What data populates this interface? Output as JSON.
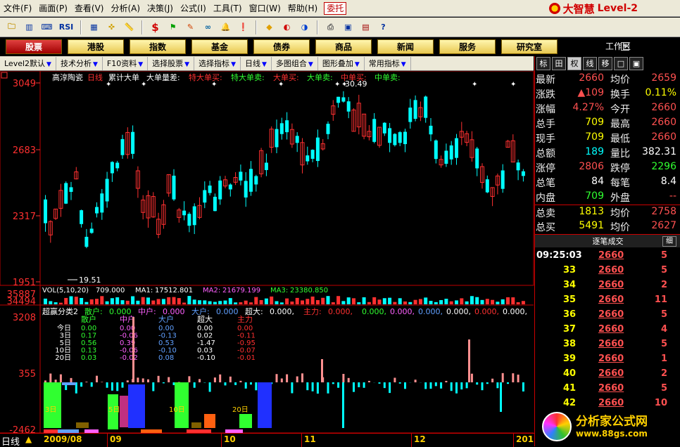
{
  "menu": {
    "items": [
      "文件(F)",
      "画面(P)",
      "查看(V)",
      "分析(A)",
      "决策(J)",
      "公式(I)",
      "工具(T)",
      "窗口(W)",
      "帮助(H)"
    ],
    "delegate": "委托",
    "brand_cn": "大智慧",
    "brand_en": "Level-2"
  },
  "toolbar": {
    "icons": [
      "folder-icon",
      "chart-icon",
      "keyboard-icon",
      "rsi-icon",
      "calc-icon",
      "crosshair-icon",
      "ruler-icon",
      "dollar-icon",
      "flag-icon",
      "pencils-icon",
      "binoculars-icon",
      "bell-icon",
      "alert-icon",
      "diamond-icon",
      "pie-red-icon",
      "pie-blue-icon",
      "printer-icon",
      "window-icon",
      "books-icon",
      "help-icon"
    ],
    "rsi_label": "RSI",
    "dollar_label": "$"
  },
  "categories": {
    "items": [
      "股票",
      "港股",
      "指数",
      "基金",
      "债券",
      "商品",
      "新闻",
      "服务",
      "研究室"
    ],
    "active_index": 0,
    "workzone": "工作区"
  },
  "subbar": {
    "items": [
      "Level2默认",
      "技术分析",
      "F10资料",
      "选择股票",
      "选择指标",
      "日线",
      "多图组合",
      "图形叠加",
      "常用指标"
    ]
  },
  "main_chart": {
    "title": "高淳陶瓷",
    "period": "日线",
    "indicators": [
      {
        "label": "累计大单",
        "color": "#ffffff"
      },
      {
        "label": "大单量差:",
        "color": "#ffffff"
      },
      {
        "label": "特大单买:",
        "color": "#ff3030"
      },
      {
        "label": "特大单卖:",
        "color": "#30ff30"
      },
      {
        "label": "大单买:",
        "color": "#ff3030"
      },
      {
        "label": "大单卖:",
        "color": "#30ff30"
      },
      {
        "label": "中单买:",
        "color": "#ff3030"
      },
      {
        "label": "中单卖:",
        "color": "#30ff30"
      }
    ],
    "y_ticks": [
      "3049",
      "2683",
      "2317",
      "1951"
    ],
    "low_marker": "19.51",
    "high_marker": "30.49"
  },
  "volume_chart": {
    "items": [
      {
        "label": "VOL(5,10,20)",
        "value": "709.000",
        "color": "#ffffff"
      },
      {
        "label": "MA1:",
        "value": "17512.801",
        "color": "#ffffff"
      },
      {
        "label": "MA2:",
        "value": "21679.199",
        "color": "#ff60ff"
      },
      {
        "label": "MA3:",
        "value": "23380.850",
        "color": "#30ff30"
      }
    ],
    "y_ticks": [
      "35887",
      "34494"
    ]
  },
  "dist_chart": {
    "title": "超赢分类2",
    "items": [
      {
        "label": "散户:",
        "value": "0.000",
        "color": "#30ff30"
      },
      {
        "label": "中户:",
        "value": "0.000",
        "color": "#ff60ff"
      },
      {
        "label": "大户:",
        "value": "0.000",
        "color": "#60a0ff"
      },
      {
        "label": "超大:",
        "value": "0.000,",
        "color": "#ffffff"
      },
      {
        "label": "主力:",
        "value": "0.000,",
        "color": "#ff3030"
      }
    ],
    "trailing": [
      "0.000,",
      "0.000,",
      "0.000,",
      "0.000,",
      "0.000,",
      "0.000,"
    ],
    "y_ticks": [
      "3208",
      "355",
      "-2462"
    ],
    "table": {
      "headers": [
        "散户",
        "中户",
        "大户",
        "超大",
        "主力"
      ],
      "rows": [
        {
          "label": "今日",
          "values": [
            "0.00",
            "0.00",
            "0.00",
            "0.00",
            "0.00"
          ]
        },
        {
          "label": "3日",
          "values": [
            "0.17",
            "-0.06",
            "-0.13",
            "0.02",
            "-0.11"
          ]
        },
        {
          "label": "5日",
          "values": [
            "0.56",
            "0.39",
            "0.53",
            "-1.47",
            "-0.95"
          ]
        },
        {
          "label": "10日",
          "values": [
            "0.13",
            "-0.06",
            "-0.10",
            "0.03",
            "-0.07"
          ]
        },
        {
          "label": "20日",
          "values": [
            "0.03",
            "-0.02",
            "0.08",
            "-0.10",
            "-0.01"
          ]
        }
      ]
    },
    "group_labels": [
      "3日",
      "5日",
      "10日",
      "20日"
    ]
  },
  "bottom": {
    "label": "日线",
    "dates": [
      "2009/08",
      "09",
      "10",
      "11",
      "12",
      "201"
    ]
  },
  "right_panel": {
    "tabs": [
      "标",
      "田",
      "权",
      "线",
      "移",
      "□",
      "▣"
    ],
    "quote": [
      {
        "l1": "最新",
        "v1": "2660",
        "c1": "#ff5050",
        "l2": "均价",
        "v2": "2659",
        "c2": "#ff5050"
      },
      {
        "l1": "涨跌",
        "v1": "▲109",
        "c1": "#ff5050",
        "l2": "换手",
        "v2": "0.11%",
        "c2": "#ffff00"
      },
      {
        "l1": "涨幅",
        "v1": "4.27%",
        "c1": "#ff5050",
        "l2": "今开",
        "v2": "2660",
        "c2": "#ff5050"
      },
      {
        "l1": "总手",
        "v1": "709",
        "c1": "#ffff00",
        "l2": "最高",
        "v2": "2660",
        "c2": "#ff5050"
      },
      {
        "l1": "现手",
        "v1": "709",
        "c1": "#ffff00",
        "l2": "最低",
        "v2": "2660",
        "c2": "#ff5050"
      },
      {
        "l1": "总额",
        "v1": "189",
        "c1": "#00ffff",
        "l2": "量比",
        "v2": "382.31",
        "c2": "#ffffff"
      },
      {
        "l1": "涨停",
        "v1": "2806",
        "c1": "#ff5050",
        "l2": "跌停",
        "v2": "2296",
        "c2": "#30ff30"
      },
      {
        "l1": "总笔",
        "v1": "84",
        "c1": "#ffffff",
        "l2": "每笔",
        "v2": "8.4",
        "c2": "#ffffff"
      },
      {
        "l1": "内盘",
        "v1": "709",
        "c1": "#30ff30",
        "l2": "外盘",
        "v2": "--",
        "c2": "#ff5050"
      },
      {
        "l1": "总卖",
        "v1": "1813",
        "c1": "#ffff00",
        "l2": "均价",
        "v2": "2758",
        "c2": "#ff5050"
      },
      {
        "l1": "总买",
        "v1": "5491",
        "c1": "#ffff00",
        "l2": "均价",
        "v2": "2627",
        "c2": "#ff5050"
      }
    ],
    "trades_title": "逐笔成交",
    "trades_btn": "细",
    "trades": [
      {
        "time": "09:25:03",
        "min": "",
        "price": "2660",
        "vol": "5"
      },
      {
        "time": "",
        "min": "33",
        "price": "2660",
        "vol": "5"
      },
      {
        "time": "",
        "min": "34",
        "price": "2660",
        "vol": "2"
      },
      {
        "time": "",
        "min": "35",
        "price": "2660",
        "vol": "11"
      },
      {
        "time": "",
        "min": "36",
        "price": "2660",
        "vol": "5"
      },
      {
        "time": "",
        "min": "37",
        "price": "2660",
        "vol": "4"
      },
      {
        "time": "",
        "min": "38",
        "price": "2660",
        "vol": "5"
      },
      {
        "time": "",
        "min": "39",
        "price": "2660",
        "vol": "1"
      },
      {
        "time": "",
        "min": "40",
        "price": "2660",
        "vol": "2"
      },
      {
        "time": "",
        "min": "41",
        "price": "2660",
        "vol": "5"
      },
      {
        "time": "",
        "min": "42",
        "price": "2660",
        "vol": "10"
      }
    ]
  },
  "watermark": {
    "text": "分析家公式网",
    "url": "www.88gs.com"
  }
}
